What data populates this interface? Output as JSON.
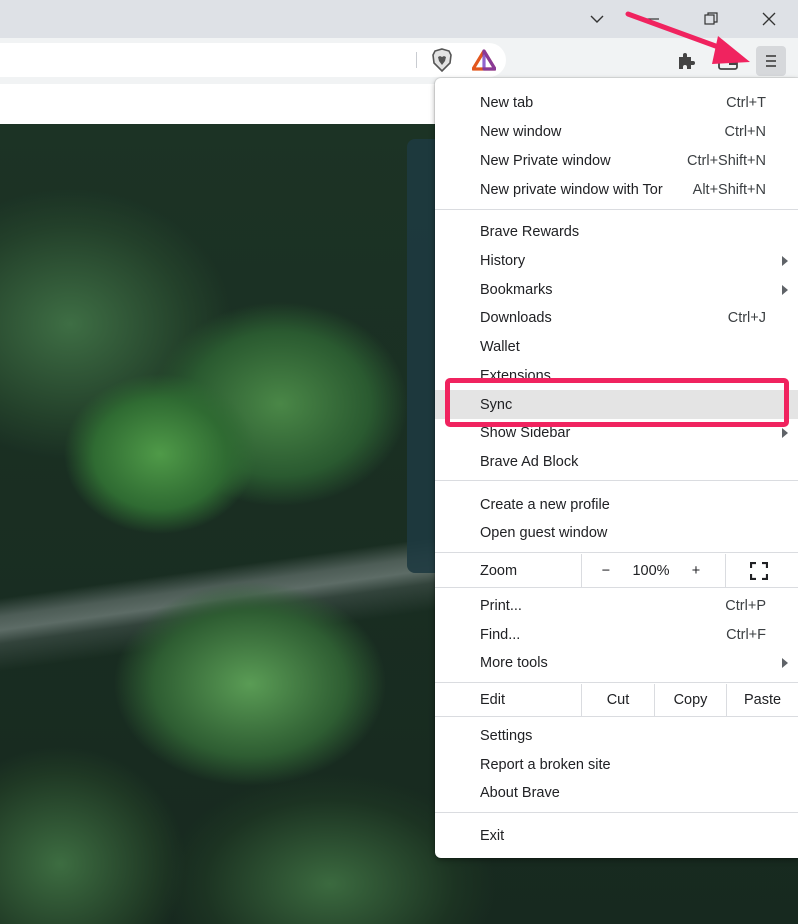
{
  "window": {
    "caption_buttons": [
      "chevron-down-icon",
      "minimize-icon",
      "restore-icon",
      "close-icon"
    ]
  },
  "toolbar": {
    "icons": [
      "brave-shields-icon",
      "brave-rewards-icon",
      "extensions-icon",
      "wallet-icon",
      "menu-icon"
    ]
  },
  "menu": {
    "new_tab": {
      "label": "New tab",
      "shortcut": "Ctrl+T"
    },
    "new_window": {
      "label": "New window",
      "shortcut": "Ctrl+N"
    },
    "new_private_window": {
      "label": "New Private window",
      "shortcut": "Ctrl+Shift+N"
    },
    "new_private_tor": {
      "label": "New private window with Tor",
      "shortcut": "Alt+Shift+N"
    },
    "brave_rewards": {
      "label": "Brave Rewards"
    },
    "history": {
      "label": "History"
    },
    "bookmarks": {
      "label": "Bookmarks"
    },
    "downloads": {
      "label": "Downloads",
      "shortcut": "Ctrl+J"
    },
    "wallet": {
      "label": "Wallet"
    },
    "extensions": {
      "label": "Extensions"
    },
    "sync": {
      "label": "Sync"
    },
    "show_sidebar": {
      "label": "Show Sidebar"
    },
    "brave_ad_block": {
      "label": "Brave Ad Block"
    },
    "create_profile": {
      "label": "Create a new profile"
    },
    "guest_window": {
      "label": "Open guest window"
    },
    "zoom": {
      "label": "Zoom",
      "minus": "−",
      "value": "100%",
      "plus": "+"
    },
    "print": {
      "label": "Print...",
      "shortcut": "Ctrl+P"
    },
    "find": {
      "label": "Find...",
      "shortcut": "Ctrl+F"
    },
    "more_tools": {
      "label": "More tools"
    },
    "edit": {
      "label": "Edit",
      "cut": "Cut",
      "copy": "Copy",
      "paste": "Paste"
    },
    "settings": {
      "label": "Settings"
    },
    "report_broken": {
      "label": "Report a broken site"
    },
    "about": {
      "label": "About Brave"
    },
    "exit": {
      "label": "Exit"
    }
  },
  "annotation": {
    "highlight_color": "#f0235f",
    "arrow_color": "#f0235f",
    "highlighted_item": "Sync"
  }
}
